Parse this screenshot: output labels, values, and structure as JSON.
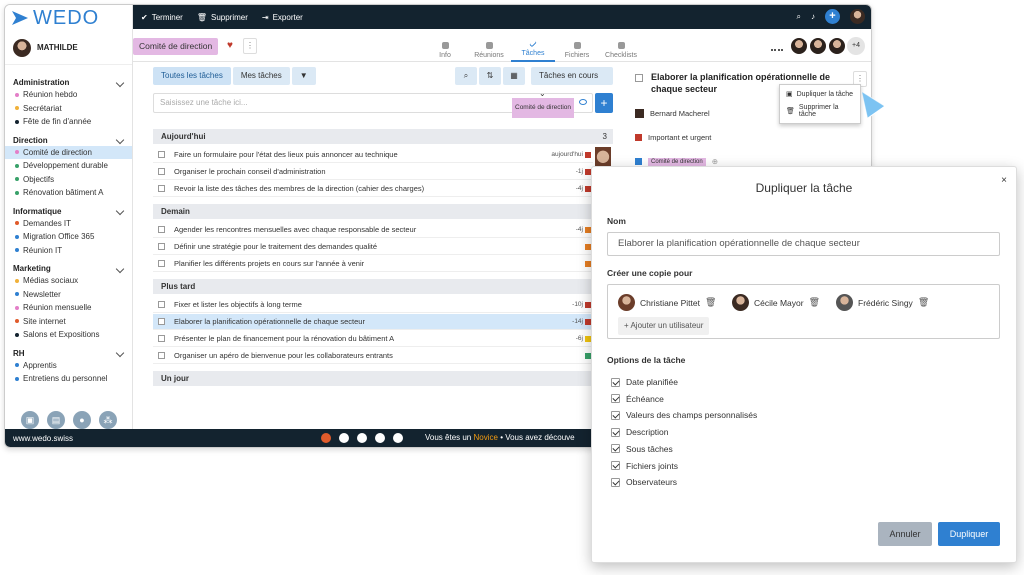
{
  "app": {
    "logo": "WEDO",
    "user": "MATHILDE"
  },
  "sidebar": {
    "groups": [
      {
        "title": "Administration",
        "items": [
          {
            "label": "Réunion hebdo",
            "color": "#e37fc8"
          },
          {
            "label": "Secrétariat",
            "color": "#f0b13a"
          },
          {
            "label": "Fête de fin d'année",
            "color": "#13232f"
          }
        ]
      },
      {
        "title": "Direction",
        "items": [
          {
            "label": "Comité de direction",
            "color": "#e37fc8",
            "selected": true
          },
          {
            "label": "Développement durable",
            "color": "#38a169"
          },
          {
            "label": "Objectifs",
            "color": "#38a169"
          },
          {
            "label": "Rénovation bâtiment A",
            "color": "#38a169"
          }
        ]
      },
      {
        "title": "Informatique",
        "items": [
          {
            "label": "Demandes IT",
            "color": "#e05b2b"
          },
          {
            "label": "Migration Office 365",
            "color": "#2f80d1"
          },
          {
            "label": "Réunion IT",
            "color": "#2f80d1"
          }
        ]
      },
      {
        "title": "Marketing",
        "items": [
          {
            "label": "Médias sociaux",
            "color": "#f0b13a"
          },
          {
            "label": "Newsletter",
            "color": "#2f80d1"
          },
          {
            "label": "Réunion mensuelle",
            "color": "#e37fc8"
          },
          {
            "label": "Site internet",
            "color": "#e05b2b"
          },
          {
            "label": "Salons et Expositions",
            "color": "#13232f"
          }
        ]
      },
      {
        "title": "RH",
        "items": [
          {
            "label": "Apprentis",
            "color": "#2f80d1"
          },
          {
            "label": "Entretiens du personnel",
            "color": "#2f80d1"
          }
        ]
      }
    ]
  },
  "topbar": {
    "finish": "Terminer",
    "delete": "Supprimer",
    "export": "Exporter"
  },
  "header": {
    "workspace": "Comité de direction",
    "tabs": [
      {
        "label": "Info"
      },
      {
        "label": "Réunions"
      },
      {
        "label": "Tâches",
        "active": true
      },
      {
        "label": "Fichiers"
      },
      {
        "label": "Checklists"
      }
    ],
    "more_members": "+4"
  },
  "list": {
    "filters": [
      "Toutes les tâches",
      "Mes tâches"
    ],
    "status": "Tâches en cours",
    "new_placeholder": "Saisissez une tâche ici...",
    "new_tag": "Comité de direction",
    "sections": [
      {
        "title": "Aujourd'hui",
        "count": "3",
        "rows": [
          {
            "text": "Faire un formulaire pour l'état des lieux puis annoncer au technique",
            "meta": "aujourd'hui",
            "pri": "#c0392b"
          },
          {
            "text": "Organiser le prochain conseil d'administration",
            "meta": "-1j",
            "pri": "#c0392b"
          },
          {
            "text": "Revoir la liste des tâches des membres de la direction (cahier des charges)",
            "meta": "-4j",
            "pri": "#c0392b"
          }
        ]
      },
      {
        "title": "Demain",
        "count": "",
        "rows": [
          {
            "text": "Agender les rencontres mensuelles avec chaque responsable de secteur",
            "meta": "-4j",
            "pri": "#e67e22"
          },
          {
            "text": "Définir une stratégie pour le traitement des demandes qualité",
            "meta": "",
            "pri": "#e67e22"
          },
          {
            "text": "Planifier les différents projets en cours sur l'année à venir",
            "meta": "",
            "pri": "#e67e22"
          }
        ]
      },
      {
        "title": "Plus tard",
        "count": "",
        "rows": [
          {
            "text": "Fixer et lister les objectifs à long terme",
            "meta": "-10j",
            "pri": "#c0392b"
          },
          {
            "text": "Elaborer la planification opérationnelle de chaque secteur",
            "meta": "-14j",
            "pri": "#c0392b",
            "selected": true
          },
          {
            "text": "Présenter le plan de financement pour la rénovation du bâtiment A",
            "meta": "-6j",
            "pri": "#f1c40f"
          },
          {
            "text": "Organiser un apéro de bienvenue pour les collaborateurs entrants",
            "meta": "",
            "pri": "#38a169"
          }
        ]
      },
      {
        "title": "Un jour",
        "count": "",
        "rows": []
      }
    ]
  },
  "detail": {
    "title": "Elaborer la planification opérationnelle de chaque secteur",
    "assignee": "Bernard Macherel",
    "priority": "Important et urgent",
    "tag": "Comité de direction"
  },
  "menu": {
    "duplicate": "Dupliquer la tâche",
    "delete": "Supprimer la tâche"
  },
  "footer": {
    "brand": "www.wedo.swiss",
    "msg_prefix": "Vous êtes un",
    "level": "Novice",
    "msg_suffix": "• Vous avez découve"
  },
  "dialog": {
    "title": "Dupliquer la tâche",
    "close": "×",
    "name_label": "Nom",
    "name_value": "Elaborer la planification opérationnelle de chaque secteur",
    "copy_label": "Créer une copie pour",
    "users": [
      "Christiane Pittet",
      "Cécile Mayor",
      "Frédéric Singy"
    ],
    "add_user": "Ajouter un utilisateur",
    "options_label": "Options de la tâche",
    "options": [
      "Date planifiée",
      "Échéance",
      "Valeurs des champs personnalisés",
      "Description",
      "Sous tâches",
      "Fichiers joints",
      "Observateurs"
    ],
    "cancel": "Annuler",
    "confirm": "Dupliquer"
  }
}
